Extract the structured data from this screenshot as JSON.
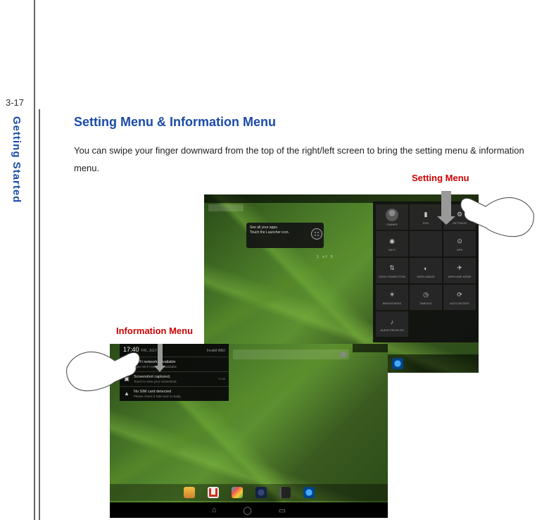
{
  "page_number": "3-17",
  "side_label": "Getting Started",
  "heading": "Setting Menu & Information Menu",
  "body_text": "You can swipe your finger downward from the top of the right/left screen to bring the setting menu & information menu.",
  "setting_menu_label": "Setting Menu",
  "information_menu_label": "Information Menu",
  "shot1": {
    "tooltip_line1": "See all your apps.",
    "tooltip_line2": "Touch the Launcher icon.",
    "pager": "1 of 5",
    "tiles": [
      {
        "label": "OWNER",
        "icon": "owner"
      },
      {
        "label": "51%",
        "icon": "battery"
      },
      {
        "label": "SETTINGS",
        "icon": "gear"
      },
      {
        "label": "WI-FI",
        "icon": "wifi"
      },
      {
        "label": "",
        "icon": ""
      },
      {
        "label": "GPS",
        "icon": "gps"
      },
      {
        "label": "DATA CONNECTION",
        "icon": "data"
      },
      {
        "label": "DATA USAGE",
        "icon": "usage"
      },
      {
        "label": "AIRPLANE MODE",
        "icon": "plane"
      },
      {
        "label": "BRIGHTNESS",
        "icon": "sun"
      },
      {
        "label": "TIMEOUT",
        "icon": "clock"
      },
      {
        "label": "AUTO ROTATE",
        "icon": "rotate"
      },
      {
        "label": "AUDIO PROFILES",
        "icon": "audio"
      }
    ]
  },
  "shot2": {
    "clock": "17:40",
    "clock_sub": "FRI, JULY 5",
    "header_right": "Invalid IMEI",
    "rows": [
      {
        "title": "Wi-Fi networks available",
        "sub": "Open Wi-Fi networks available",
        "icon": "wifi"
      },
      {
        "title": "Screenshot captured.",
        "sub": "Touch to view your screenshot.",
        "time": "17:39",
        "icon": "image"
      },
      {
        "title": "No SIM card detected",
        "sub": "Please check if SIM card is ready.",
        "icon": "warn"
      }
    ]
  }
}
